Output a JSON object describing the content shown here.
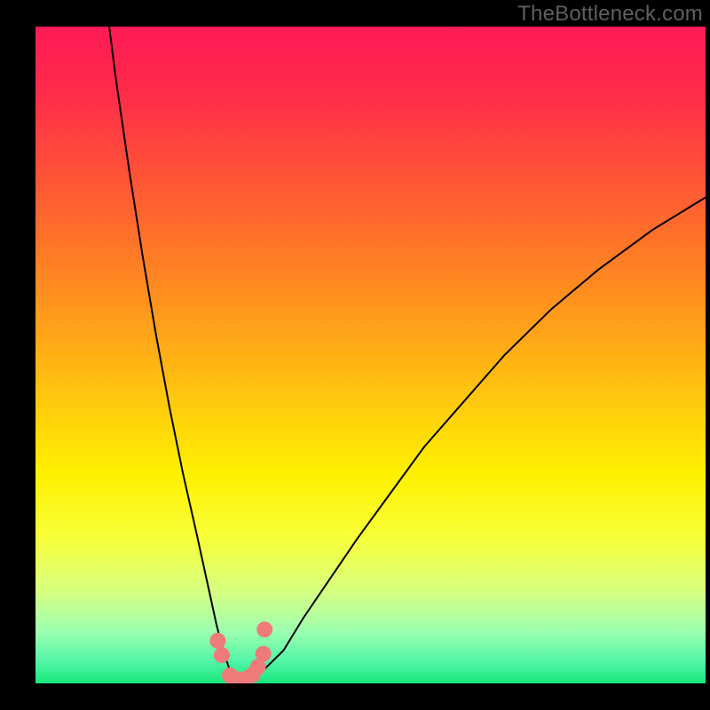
{
  "watermark": "TheBottleneck.com",
  "colors": {
    "background": "#000000",
    "watermark": "#5f5f5f",
    "gradient_stops": [
      {
        "offset": 0.0,
        "color": "#ff1a55"
      },
      {
        "offset": 0.1,
        "color": "#ff2b4a"
      },
      {
        "offset": 0.25,
        "color": "#ff5a33"
      },
      {
        "offset": 0.4,
        "color": "#ff8c1f"
      },
      {
        "offset": 0.55,
        "color": "#ffc210"
      },
      {
        "offset": 0.68,
        "color": "#fff000"
      },
      {
        "offset": 0.78,
        "color": "#f7ff3a"
      },
      {
        "offset": 0.86,
        "color": "#d6ff80"
      },
      {
        "offset": 0.92,
        "color": "#9dffb0"
      },
      {
        "offset": 0.965,
        "color": "#55f5a8"
      },
      {
        "offset": 1.0,
        "color": "#17e87c"
      }
    ],
    "curve": "#000000",
    "dots": "#ef7a7a"
  },
  "chart_data": {
    "type": "line",
    "title": "",
    "xlabel": "",
    "ylabel": "",
    "xlim": [
      0,
      100
    ],
    "ylim": [
      0,
      100
    ],
    "x": [
      11,
      12,
      14,
      16,
      18,
      20,
      22,
      24,
      25.5,
      27,
      28,
      29,
      30,
      31,
      32,
      34,
      37,
      40,
      44,
      48,
      53,
      58,
      64,
      70,
      77,
      84,
      92,
      100
    ],
    "values": [
      100,
      92,
      78,
      65,
      53,
      42,
      32,
      23,
      16,
      9,
      5,
      2,
      0.5,
      0.2,
      0.5,
      2,
      5,
      10,
      16,
      22,
      29,
      36,
      43,
      50,
      57,
      63,
      69,
      74
    ],
    "series": [
      {
        "name": "left-branch",
        "x": [
          11,
          12,
          14,
          16,
          18,
          20,
          22,
          24,
          25.5,
          27,
          28,
          29,
          30
        ],
        "y": [
          100,
          92,
          78,
          65,
          53,
          42,
          32,
          23,
          16,
          9,
          5,
          2,
          0.5
        ]
      },
      {
        "name": "right-branch",
        "x": [
          30,
          31,
          32,
          34,
          37,
          40,
          44,
          48,
          53,
          58,
          64,
          70,
          77,
          84,
          92,
          100
        ],
        "y": [
          0.5,
          0.2,
          0.5,
          2,
          5,
          10,
          16,
          22,
          29,
          36,
          43,
          50,
          57,
          63,
          69,
          74
        ]
      }
    ],
    "markers": {
      "name": "dots-near-minimum",
      "x": [
        27.2,
        27.8,
        29.0,
        30.2,
        31.4,
        32.4,
        33.2,
        34.0,
        34.2
      ],
      "y": [
        6.5,
        4.3,
        1.2,
        0.6,
        0.7,
        1.3,
        2.5,
        4.5,
        8.2
      ]
    },
    "annotations": []
  }
}
